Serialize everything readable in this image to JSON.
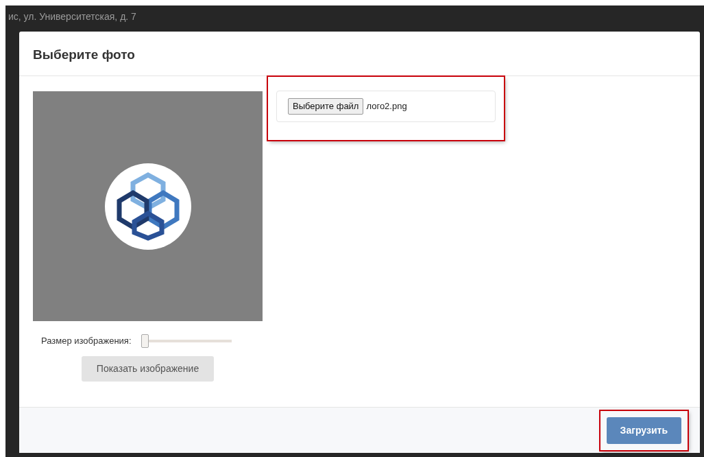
{
  "background": {
    "address_fragment": "ис, ул. Университетская, д. 7"
  },
  "modal": {
    "title": "Выберите фото",
    "size_slider": {
      "label": "Размер изображения:",
      "level": 0
    },
    "show_button": {
      "label": "Показать изображение"
    },
    "file_input": {
      "button_label": "Выберите файл",
      "file_name": "лого2.png",
      "highlighted": true
    },
    "upload_button": {
      "label": "Загрузить",
      "highlighted": true
    }
  }
}
